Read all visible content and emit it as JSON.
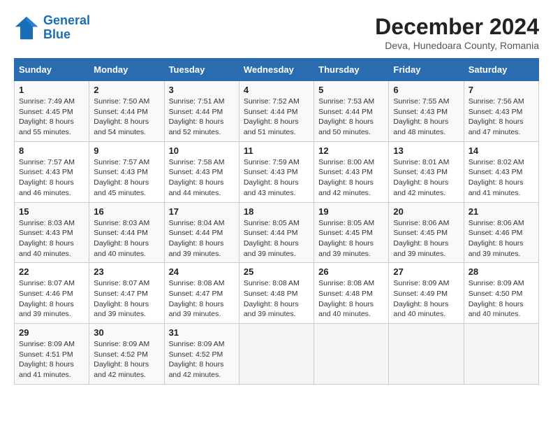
{
  "header": {
    "logo_line1": "General",
    "logo_line2": "Blue",
    "month_year": "December 2024",
    "location": "Deva, Hunedoara County, Romania"
  },
  "weekdays": [
    "Sunday",
    "Monday",
    "Tuesday",
    "Wednesday",
    "Thursday",
    "Friday",
    "Saturday"
  ],
  "weeks": [
    [
      {
        "day": "1",
        "sunrise": "7:49 AM",
        "sunset": "4:45 PM",
        "daylight": "8 hours and 55 minutes."
      },
      {
        "day": "2",
        "sunrise": "7:50 AM",
        "sunset": "4:44 PM",
        "daylight": "8 hours and 54 minutes."
      },
      {
        "day": "3",
        "sunrise": "7:51 AM",
        "sunset": "4:44 PM",
        "daylight": "8 hours and 52 minutes."
      },
      {
        "day": "4",
        "sunrise": "7:52 AM",
        "sunset": "4:44 PM",
        "daylight": "8 hours and 51 minutes."
      },
      {
        "day": "5",
        "sunrise": "7:53 AM",
        "sunset": "4:44 PM",
        "daylight": "8 hours and 50 minutes."
      },
      {
        "day": "6",
        "sunrise": "7:55 AM",
        "sunset": "4:43 PM",
        "daylight": "8 hours and 48 minutes."
      },
      {
        "day": "7",
        "sunrise": "7:56 AM",
        "sunset": "4:43 PM",
        "daylight": "8 hours and 47 minutes."
      }
    ],
    [
      {
        "day": "8",
        "sunrise": "7:57 AM",
        "sunset": "4:43 PM",
        "daylight": "8 hours and 46 minutes."
      },
      {
        "day": "9",
        "sunrise": "7:57 AM",
        "sunset": "4:43 PM",
        "daylight": "8 hours and 45 minutes."
      },
      {
        "day": "10",
        "sunrise": "7:58 AM",
        "sunset": "4:43 PM",
        "daylight": "8 hours and 44 minutes."
      },
      {
        "day": "11",
        "sunrise": "7:59 AM",
        "sunset": "4:43 PM",
        "daylight": "8 hours and 43 minutes."
      },
      {
        "day": "12",
        "sunrise": "8:00 AM",
        "sunset": "4:43 PM",
        "daylight": "8 hours and 42 minutes."
      },
      {
        "day": "13",
        "sunrise": "8:01 AM",
        "sunset": "4:43 PM",
        "daylight": "8 hours and 42 minutes."
      },
      {
        "day": "14",
        "sunrise": "8:02 AM",
        "sunset": "4:43 PM",
        "daylight": "8 hours and 41 minutes."
      }
    ],
    [
      {
        "day": "15",
        "sunrise": "8:03 AM",
        "sunset": "4:43 PM",
        "daylight": "8 hours and 40 minutes."
      },
      {
        "day": "16",
        "sunrise": "8:03 AM",
        "sunset": "4:44 PM",
        "daylight": "8 hours and 40 minutes."
      },
      {
        "day": "17",
        "sunrise": "8:04 AM",
        "sunset": "4:44 PM",
        "daylight": "8 hours and 39 minutes."
      },
      {
        "day": "18",
        "sunrise": "8:05 AM",
        "sunset": "4:44 PM",
        "daylight": "8 hours and 39 minutes."
      },
      {
        "day": "19",
        "sunrise": "8:05 AM",
        "sunset": "4:45 PM",
        "daylight": "8 hours and 39 minutes."
      },
      {
        "day": "20",
        "sunrise": "8:06 AM",
        "sunset": "4:45 PM",
        "daylight": "8 hours and 39 minutes."
      },
      {
        "day": "21",
        "sunrise": "8:06 AM",
        "sunset": "4:46 PM",
        "daylight": "8 hours and 39 minutes."
      }
    ],
    [
      {
        "day": "22",
        "sunrise": "8:07 AM",
        "sunset": "4:46 PM",
        "daylight": "8 hours and 39 minutes."
      },
      {
        "day": "23",
        "sunrise": "8:07 AM",
        "sunset": "4:47 PM",
        "daylight": "8 hours and 39 minutes."
      },
      {
        "day": "24",
        "sunrise": "8:08 AM",
        "sunset": "4:47 PM",
        "daylight": "8 hours and 39 minutes."
      },
      {
        "day": "25",
        "sunrise": "8:08 AM",
        "sunset": "4:48 PM",
        "daylight": "8 hours and 39 minutes."
      },
      {
        "day": "26",
        "sunrise": "8:08 AM",
        "sunset": "4:48 PM",
        "daylight": "8 hours and 40 minutes."
      },
      {
        "day": "27",
        "sunrise": "8:09 AM",
        "sunset": "4:49 PM",
        "daylight": "8 hours and 40 minutes."
      },
      {
        "day": "28",
        "sunrise": "8:09 AM",
        "sunset": "4:50 PM",
        "daylight": "8 hours and 40 minutes."
      }
    ],
    [
      {
        "day": "29",
        "sunrise": "8:09 AM",
        "sunset": "4:51 PM",
        "daylight": "8 hours and 41 minutes."
      },
      {
        "day": "30",
        "sunrise": "8:09 AM",
        "sunset": "4:52 PM",
        "daylight": "8 hours and 42 minutes."
      },
      {
        "day": "31",
        "sunrise": "8:09 AM",
        "sunset": "4:52 PM",
        "daylight": "8 hours and 42 minutes."
      },
      null,
      null,
      null,
      null
    ]
  ]
}
